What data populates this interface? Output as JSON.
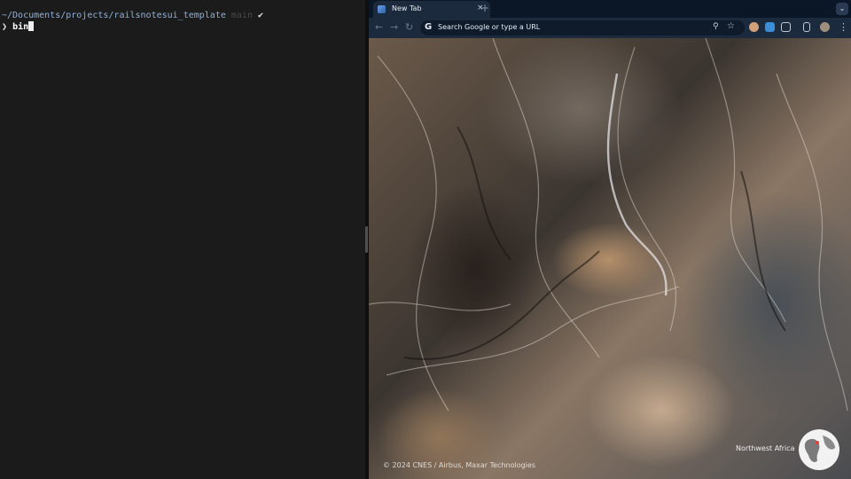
{
  "terminal": {
    "path": "~/Documents/projects/railsnotesui_template",
    "branch": "main",
    "status_mark": "✔",
    "prompt_symbol": "❯",
    "command": "bin"
  },
  "browser": {
    "tab": {
      "title": "New Tab",
      "close": "×"
    },
    "new_tab": "+",
    "tab_menu": "⌄",
    "nav": {
      "back": "←",
      "forward": "→",
      "reload": "↻"
    },
    "omnibox": {
      "google_glyph": "G",
      "placeholder": "Search Google or type a URL",
      "zoom_icon": "⚲",
      "star_icon": "☆"
    },
    "menu": "⋮",
    "wallpaper": {
      "credit": "© 2024 CNES / Airbus, Maxar Technologies",
      "location": "Northwest Africa"
    },
    "colors": {
      "tab_active": "#1c2a3d",
      "tabstrip": "#0b1727",
      "terminal_bg": "#1b1b1b",
      "path": "#8fb0d8"
    }
  }
}
